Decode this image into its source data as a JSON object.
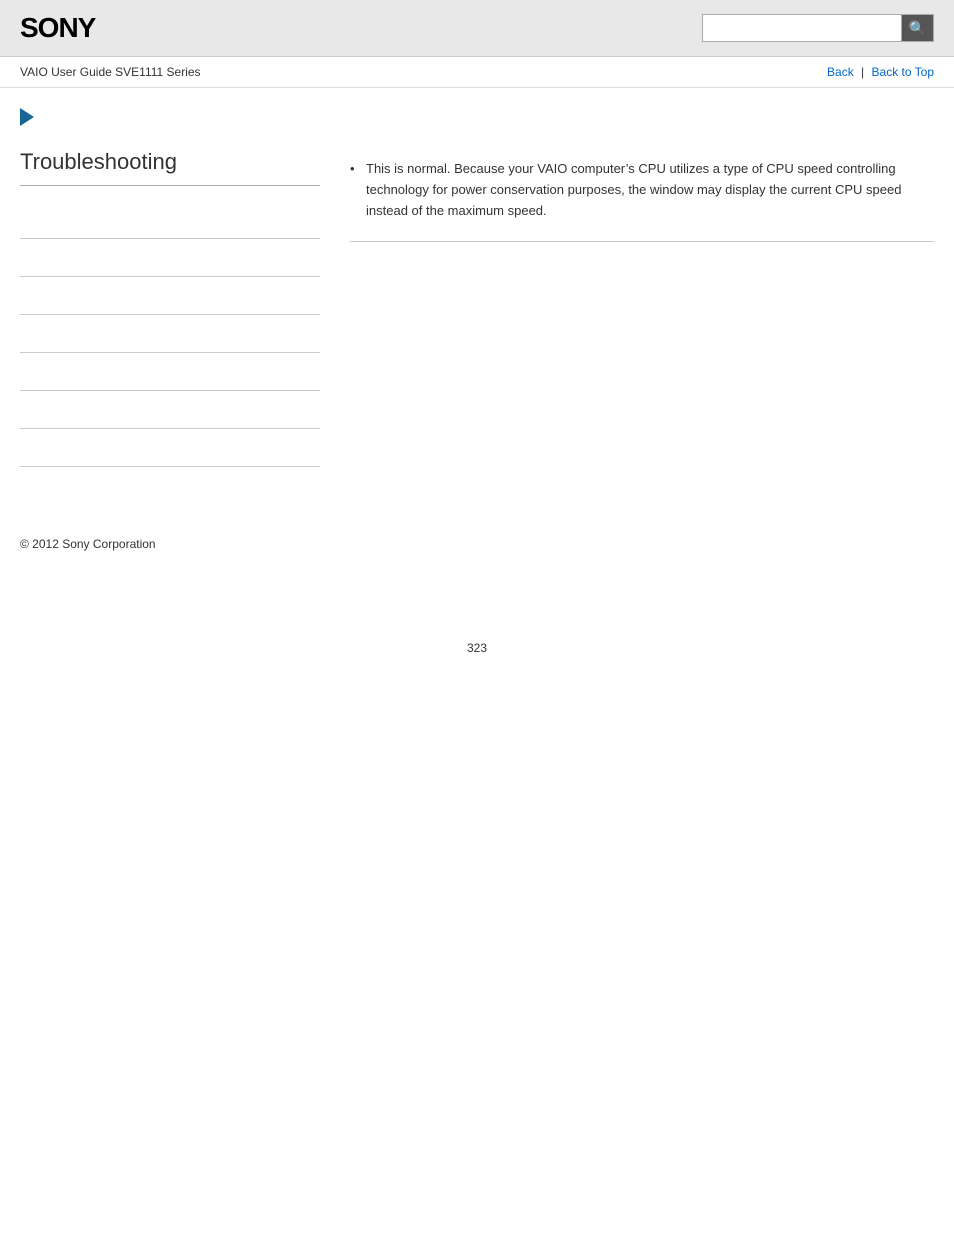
{
  "header": {
    "logo": "SONY",
    "search_placeholder": "",
    "search_icon": "🔍"
  },
  "nav": {
    "guide_title": "VAIO User Guide SVE1111 Series",
    "back_label": "Back",
    "back_to_top_label": "Back to Top",
    "separator": "|"
  },
  "sidebar": {
    "heading": "Troubleshooting",
    "items": [
      {
        "label": ""
      },
      {
        "label": ""
      },
      {
        "label": ""
      },
      {
        "label": ""
      },
      {
        "label": ""
      },
      {
        "label": ""
      },
      {
        "label": ""
      }
    ]
  },
  "main_content": {
    "answer_text": "This is normal. Because your VAIO computer’s CPU utilizes a type of CPU speed controlling technology for power conservation purposes, the window may display the current CPU speed instead of the maximum speed."
  },
  "footer": {
    "copyright": "© 2012 Sony Corporation"
  },
  "page_number": "323"
}
